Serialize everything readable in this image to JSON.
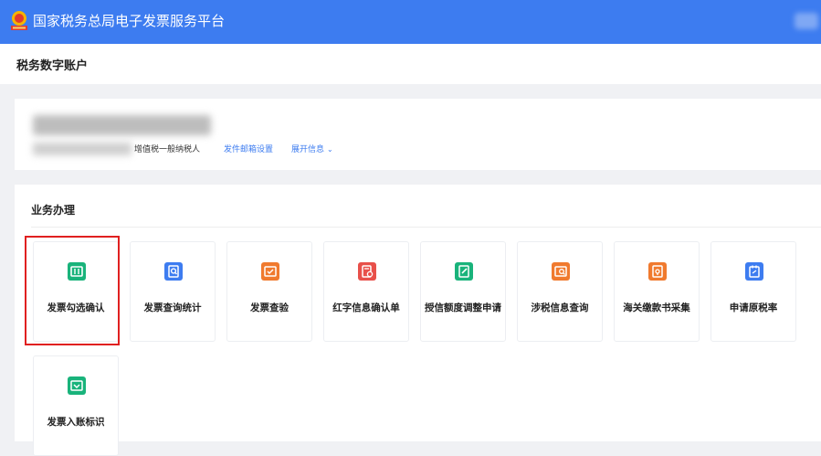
{
  "header": {
    "app_title": "国家税务总局电子发票服务平台",
    "brand_color": "#3d7cf0"
  },
  "page": {
    "title": "税务数字账户"
  },
  "account": {
    "taxpayer_type": "增值税一般纳税人",
    "email_link": "发件邮箱设置",
    "expand_link": "展开信息"
  },
  "business": {
    "title": "业务办理",
    "tiles": [
      {
        "label": "发票勾选确认",
        "icon": "invoice-check-icon",
        "color": "#19b37b"
      },
      {
        "label": "发票查询统计",
        "icon": "invoice-search-icon",
        "color": "#3d7cf0"
      },
      {
        "label": "发票查验",
        "icon": "invoice-verify-icon",
        "color": "#f07a2e"
      },
      {
        "label": "红字信息确认单",
        "icon": "red-info-icon",
        "color": "#e8504a"
      },
      {
        "label": "授信额度调整申请",
        "icon": "credit-adjust-icon",
        "color": "#19b37b"
      },
      {
        "label": "涉税信息查询",
        "icon": "tax-info-search-icon",
        "color": "#f07a2e"
      },
      {
        "label": "海关缴款书采集",
        "icon": "customs-payment-icon",
        "color": "#f07a2e"
      },
      {
        "label": "申请原税率",
        "icon": "original-rate-icon",
        "color": "#3d7cf0"
      },
      {
        "label": "发票入账标识",
        "icon": "invoice-booking-icon",
        "color": "#19b37b"
      }
    ]
  }
}
